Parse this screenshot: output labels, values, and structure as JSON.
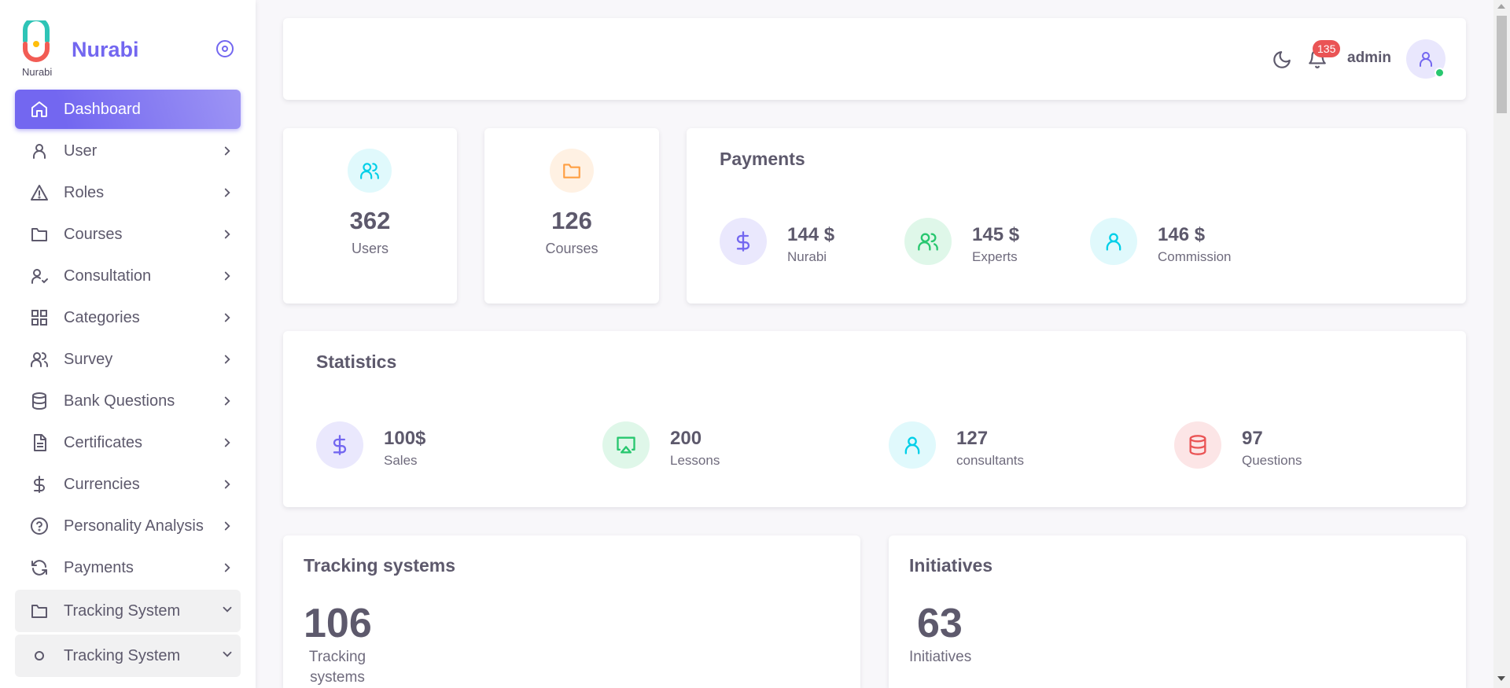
{
  "brand": {
    "name": "Nurabi",
    "logo_text": "Nurabi"
  },
  "sidebar": {
    "items": [
      {
        "label": "Dashboard",
        "icon": "home-icon"
      },
      {
        "label": "User",
        "icon": "user-icon"
      },
      {
        "label": "Roles",
        "icon": "alert-triangle-icon"
      },
      {
        "label": "Courses",
        "icon": "folder-icon"
      },
      {
        "label": "Consultation",
        "icon": "user-check-icon"
      },
      {
        "label": "Categories",
        "icon": "grid-icon"
      },
      {
        "label": "Survey",
        "icon": "users-icon"
      },
      {
        "label": "Bank Questions",
        "icon": "database-icon"
      },
      {
        "label": "Certificates",
        "icon": "file-text-icon"
      },
      {
        "label": "Currencies",
        "icon": "dollar-icon"
      },
      {
        "label": "Personality Analysis",
        "icon": "help-circle-icon"
      },
      {
        "label": "Payments",
        "icon": "refresh-icon"
      },
      {
        "label": "Tracking System",
        "icon": "folder-icon"
      },
      {
        "label": "Tracking System",
        "icon": "circle-icon"
      }
    ]
  },
  "navbar": {
    "notifications": "135",
    "username": "admin"
  },
  "stats_cards": [
    {
      "value": "362",
      "label": "Users",
      "icon": "users-icon",
      "color": "#00cfe8"
    },
    {
      "value": "126",
      "label": "Courses",
      "icon": "folder-icon",
      "color": "#ff9f43"
    }
  ],
  "payments": {
    "title": "Payments",
    "items": [
      {
        "value": "144 $",
        "label": "Nurabi",
        "icon": "dollar-icon",
        "color": "#7367f0"
      },
      {
        "value": "145 $",
        "label": "Experts",
        "icon": "users-icon",
        "color": "#28c76f"
      },
      {
        "value": "146 $",
        "label": "Commission",
        "icon": "user-icon",
        "color": "#00cfe8"
      }
    ]
  },
  "statistics": {
    "title": "Statistics",
    "items": [
      {
        "value": "100$",
        "label": "Sales",
        "icon": "dollar-icon",
        "color": "#7367f0"
      },
      {
        "value": "200",
        "label": "Lessons",
        "icon": "cast-icon",
        "color": "#28c76f"
      },
      {
        "value": "127",
        "label": "consultants",
        "icon": "user-icon",
        "color": "#00cfe8"
      },
      {
        "value": "97",
        "label": "Questions",
        "icon": "database-icon",
        "color": "#ea5455"
      }
    ]
  },
  "tracking": {
    "title": "Tracking systems",
    "value": "106",
    "label_line1": "Tracking",
    "label_line2": "systems"
  },
  "initiatives": {
    "title": "Initiatives",
    "value": "63",
    "label": "Initiatives"
  }
}
